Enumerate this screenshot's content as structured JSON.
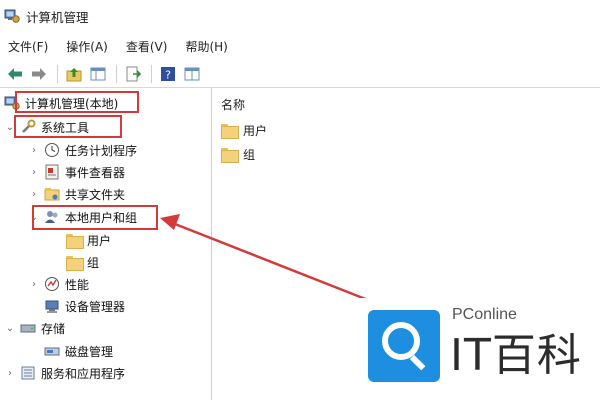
{
  "window": {
    "title": "计算机管理",
    "icon": "computer-management-icon"
  },
  "menubar": {
    "items": [
      "文件(F)",
      "操作(A)",
      "查看(V)",
      "帮助(H)"
    ]
  },
  "toolbar": {
    "buttons": [
      "back-arrow-icon",
      "forward-arrow-icon",
      "up-folder-icon",
      "show-hide-tree-icon",
      "export-list-icon",
      "help-icon",
      "properties-icon"
    ]
  },
  "tree": {
    "root": "计算机管理(本地)",
    "system_tools": "系统工具",
    "task_scheduler": "任务计划程序",
    "event_viewer": "事件查看器",
    "shared_folders": "共享文件夹",
    "local_users_groups": "本地用户和组",
    "users": "用户",
    "groups": "组",
    "performance": "性能",
    "device_manager": "设备管理器",
    "storage": "存储",
    "disk_management": "磁盘管理",
    "services_apps": "服务和应用程序"
  },
  "list": {
    "column_name": "名称",
    "items": [
      "用户",
      "组"
    ]
  },
  "watermark": {
    "brand": "PConline",
    "big_text": "IT百科"
  },
  "colors": {
    "highlight_red": "#d33b3b",
    "brand_blue": "#1e8ee0",
    "folder_yellow": "#f3d27b"
  }
}
